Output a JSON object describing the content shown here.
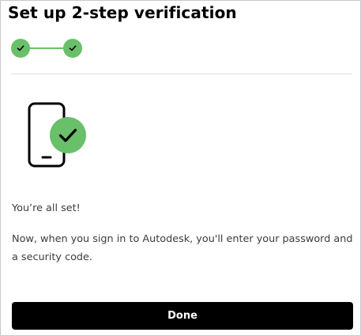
{
  "dialog": {
    "title": "Set up 2-step verification"
  },
  "stepper": {
    "steps": [
      {
        "state": "complete",
        "icon": "checkmark-icon"
      },
      {
        "state": "complete",
        "icon": "checkmark-icon"
      }
    ],
    "color": "#6abf6a"
  },
  "illustration": {
    "icons": [
      "phone-icon",
      "check-circle-icon"
    ],
    "accent": "#6abf6a"
  },
  "message": {
    "heading": "You’re all set!",
    "body": "Now, when you sign in to Autodesk, you'll enter your password and a security code."
  },
  "actions": {
    "done_label": "Done"
  },
  "colors": {
    "primary_button": "#000000",
    "success": "#6abf6a"
  }
}
